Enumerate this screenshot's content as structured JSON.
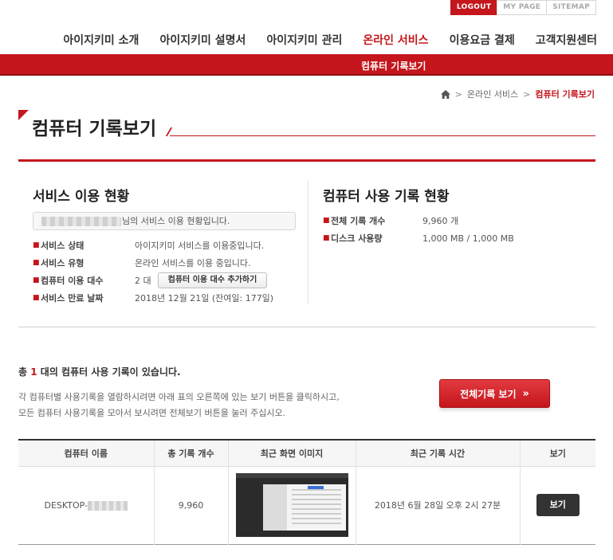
{
  "util": {
    "logout": "LOGOUT",
    "mypage": "MY PAGE",
    "sitemap": "SITEMAP"
  },
  "nav": {
    "items": [
      "아이지키미 소개",
      "아이지키미 설명서",
      "아이지키미 관리",
      "온라인 서비스",
      "이용요금 결제",
      "고객지원센터"
    ],
    "active_index": 3
  },
  "subnav": {
    "current": "컴퓨터 기록보기"
  },
  "breadcrumb": {
    "sep": ">",
    "parent": "온라인 서비스",
    "current": "컴퓨터 기록보기"
  },
  "page": {
    "title": "컴퓨터 기록보기"
  },
  "service": {
    "title": "서비스 이용 현황",
    "user_suffix": "님의 서비스 이용 현황입니다.",
    "rows": [
      {
        "label": "서비스 상태",
        "value": "아이지키미 서비스를 이용중입니다."
      },
      {
        "label": "서비스 유형",
        "value": "온라인 서비스를 이용 중입니다."
      },
      {
        "label": "컴퓨터 이용 대수",
        "value": "2 대"
      },
      {
        "label": "서비스 만료 날짜",
        "value": "2018년 12월 21일 (잔여일: 177일)"
      }
    ],
    "add_button": "컴퓨터 이용 대수 추가하기"
  },
  "usage": {
    "title": "컴퓨터 사용 기록 현황",
    "rows": [
      {
        "label": "전체 기록 개수",
        "value": "9,960 개"
      },
      {
        "label": "디스크 사용량",
        "value": "1,000 MB / 1,000 MB"
      }
    ]
  },
  "records": {
    "count_prefix": "총",
    "count": "1",
    "count_suffix": "대의 컴퓨터 사용 기록이 있습니다.",
    "desc_line1": "각 컴퓨터별 사용기록을 열람하시려면 아래 표의 오른쪽에 있는 보기 버튼을 클릭하시고,",
    "desc_line2": "모든 컴퓨터 사용기록을 모아서 보시려면 전체보기 버튼을 눌러 주십시오.",
    "all_button": "전체기록 보기",
    "all_button_chevron": "»"
  },
  "table": {
    "headers": [
      "컴퓨터 이름",
      "총 기록 개수",
      "최근 화면 이미지",
      "최근 기록 시간",
      "보기"
    ],
    "rows": [
      {
        "name_prefix": "DESKTOP-",
        "count": "9,960",
        "time": "2018년 6월 28일 오후 2시 27분",
        "view": "보기"
      }
    ]
  },
  "colors": {
    "accent": "#c4161c",
    "dark": "#333333"
  }
}
